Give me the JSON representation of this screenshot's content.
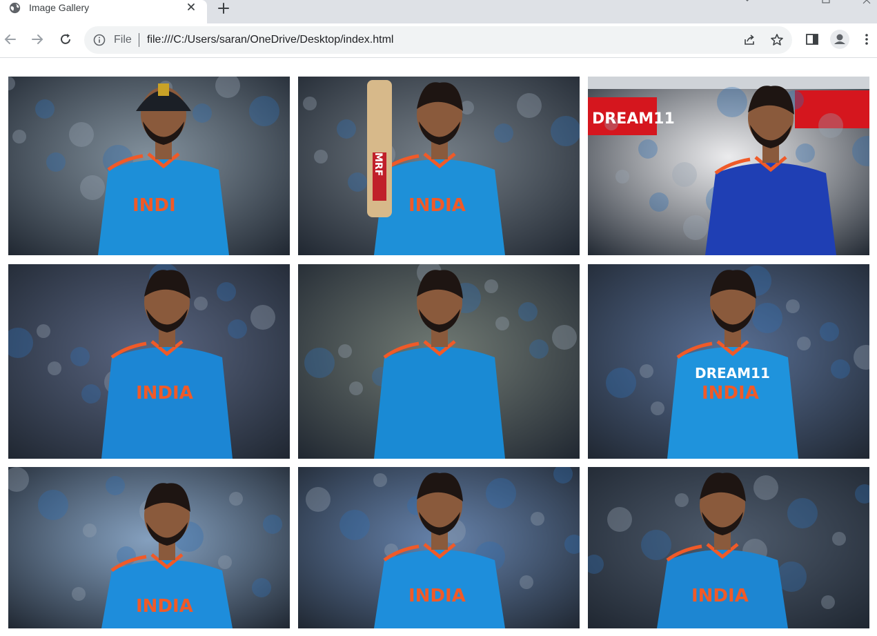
{
  "browser": {
    "tab": {
      "title": "Image Gallery",
      "icon": "globe-icon",
      "close_icon": "close-icon"
    },
    "new_tab_icon": "plus-icon",
    "omnibox": {
      "scheme_label": "File",
      "url": "file:///C:/Users/saran/OneDrive/Desktop/index.html",
      "info_icon": "info-icon",
      "share_icon": "share-icon",
      "bookmark_icon": "star-icon"
    },
    "toolbar_icons": [
      "back-arrow-icon",
      "forward-arrow-icon",
      "reload-icon",
      "side-panel-icon",
      "profile-icon",
      "kebab-menu-icon"
    ]
  },
  "gallery": {
    "photos": [
      {
        "name": "photo-1",
        "text": "INDI",
        "background": "#6b7c8a",
        "jersey": "#1d8fd8",
        "extra_text": ""
      },
      {
        "name": "photo-2",
        "text": "INDIA",
        "background": "#5b6670",
        "jersey": "#1e90d8",
        "extra_text": "MRF"
      },
      {
        "name": "photo-3",
        "text": "",
        "background": "#e8e8ea",
        "jersey": "#1f3fb4",
        "extra_text": "DREAM11"
      },
      {
        "name": "photo-4",
        "text": "INDIA",
        "background": "#3c4a6a",
        "jersey": "#1c86d4",
        "extra_text": ""
      },
      {
        "name": "photo-5",
        "text": "",
        "background": "#56615a",
        "jersey": "#1a8ad4",
        "extra_text": ""
      },
      {
        "name": "photo-6",
        "text": "INDIA",
        "background": "#3b5580",
        "jersey": "#1f93dc",
        "extra_text": "DREAM11"
      },
      {
        "name": "photo-7",
        "text": "INDIA",
        "background": "#6f8fb3",
        "jersey": "#1e8ddb",
        "extra_text": ""
      },
      {
        "name": "photo-8",
        "text": "INDIA",
        "background": "#4a6b9a",
        "jersey": "#1e8edb",
        "extra_text": ""
      },
      {
        "name": "photo-9",
        "text": "INDIA",
        "background": "#2f3e52",
        "jersey": "#1d86d2",
        "extra_text": ""
      }
    ]
  },
  "colors": {
    "tabstrip": "#dee1e6",
    "omnibox": "#f1f3f4",
    "jersey_orange": "#f05a28"
  }
}
